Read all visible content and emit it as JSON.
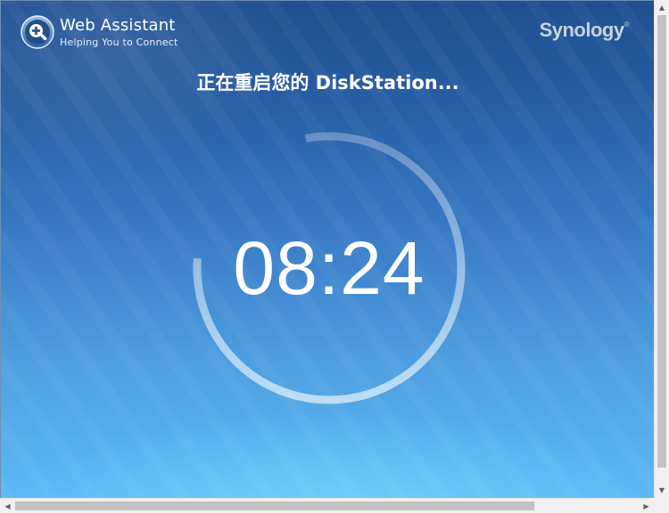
{
  "header": {
    "app_name": "Web Assistant",
    "tagline": "Helping You to Connect",
    "app_icon": "magnifier-plus-icon",
    "vendor_logo_text": "Synology",
    "vendor_logo_mark": "®"
  },
  "main": {
    "status_message": "正在重启您的 DiskStation...",
    "countdown": "08:24",
    "countdown_progress": 0.79
  },
  "scrollbars": {
    "up_icon": "triangle-up-icon",
    "down_icon": "triangle-down-icon",
    "left_icon": "triangle-left-icon",
    "right_icon": "triangle-right-icon"
  },
  "colors": {
    "background_top": "#1f4f91",
    "background_bottom": "#5cb9f6",
    "text": "#ffffff",
    "vendor_logo": "#c9d3df",
    "ring": "#ffffff"
  }
}
